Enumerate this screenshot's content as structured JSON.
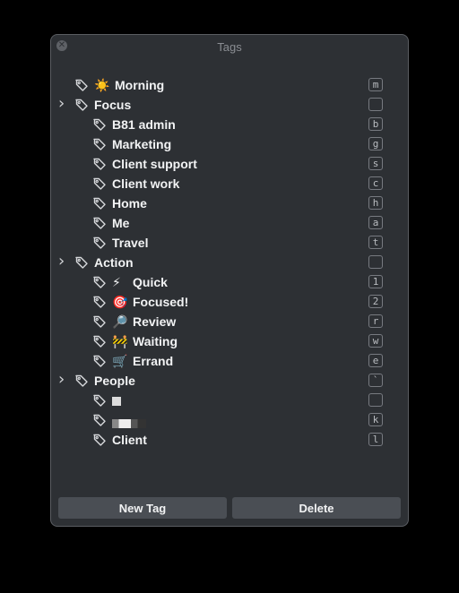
{
  "window": {
    "title": "Tags",
    "close_glyph": "✕"
  },
  "tags": [
    {
      "depth": 0,
      "expandable": false,
      "emoji": "☀️",
      "label": "Morning",
      "shortcut": "m"
    },
    {
      "depth": 0,
      "expandable": true,
      "emoji": "",
      "label": "Focus",
      "shortcut": ""
    },
    {
      "depth": 1,
      "expandable": false,
      "emoji": "",
      "label": "B81 admin",
      "shortcut": "b"
    },
    {
      "depth": 1,
      "expandable": false,
      "emoji": "",
      "label": "Marketing",
      "shortcut": "g"
    },
    {
      "depth": 1,
      "expandable": false,
      "emoji": "",
      "label": "Client support",
      "shortcut": "s"
    },
    {
      "depth": 1,
      "expandable": false,
      "emoji": "",
      "label": "Client work",
      "shortcut": "c"
    },
    {
      "depth": 1,
      "expandable": false,
      "emoji": "",
      "label": "Home",
      "shortcut": "h"
    },
    {
      "depth": 1,
      "expandable": false,
      "emoji": "",
      "label": "Me",
      "shortcut": "a"
    },
    {
      "depth": 1,
      "expandable": false,
      "emoji": "",
      "label": "Travel",
      "shortcut": "t"
    },
    {
      "depth": 0,
      "expandable": true,
      "emoji": "",
      "label": "Action",
      "shortcut": ""
    },
    {
      "depth": 1,
      "expandable": false,
      "emoji": "⚡",
      "label": "Quick",
      "shortcut": "1"
    },
    {
      "depth": 1,
      "expandable": false,
      "emoji": "🎯",
      "label": "Focused!",
      "shortcut": "2"
    },
    {
      "depth": 1,
      "expandable": false,
      "emoji": "🔎",
      "label": "Review",
      "shortcut": "r"
    },
    {
      "depth": 1,
      "expandable": false,
      "emoji": "🚧",
      "label": "Waiting",
      "shortcut": "w"
    },
    {
      "depth": 1,
      "expandable": false,
      "emoji": "🛒",
      "label": "Errand",
      "shortcut": "e"
    },
    {
      "depth": 0,
      "expandable": true,
      "emoji": "",
      "label": "People",
      "shortcut": "`"
    },
    {
      "depth": 1,
      "expandable": false,
      "emoji": "",
      "label": "",
      "redacted": "a",
      "shortcut": ""
    },
    {
      "depth": 1,
      "expandable": false,
      "emoji": "",
      "label": "",
      "redacted": "b",
      "shortcut": "k"
    },
    {
      "depth": 1,
      "expandable": false,
      "emoji": "",
      "label": "Client",
      "shortcut": "l"
    }
  ],
  "footer": {
    "new_tag_label": "New Tag",
    "delete_label": "Delete"
  },
  "colors": {
    "window_bg": "#2d3034",
    "button_bg": "#4a4e54",
    "text": "#f2f3f4"
  }
}
